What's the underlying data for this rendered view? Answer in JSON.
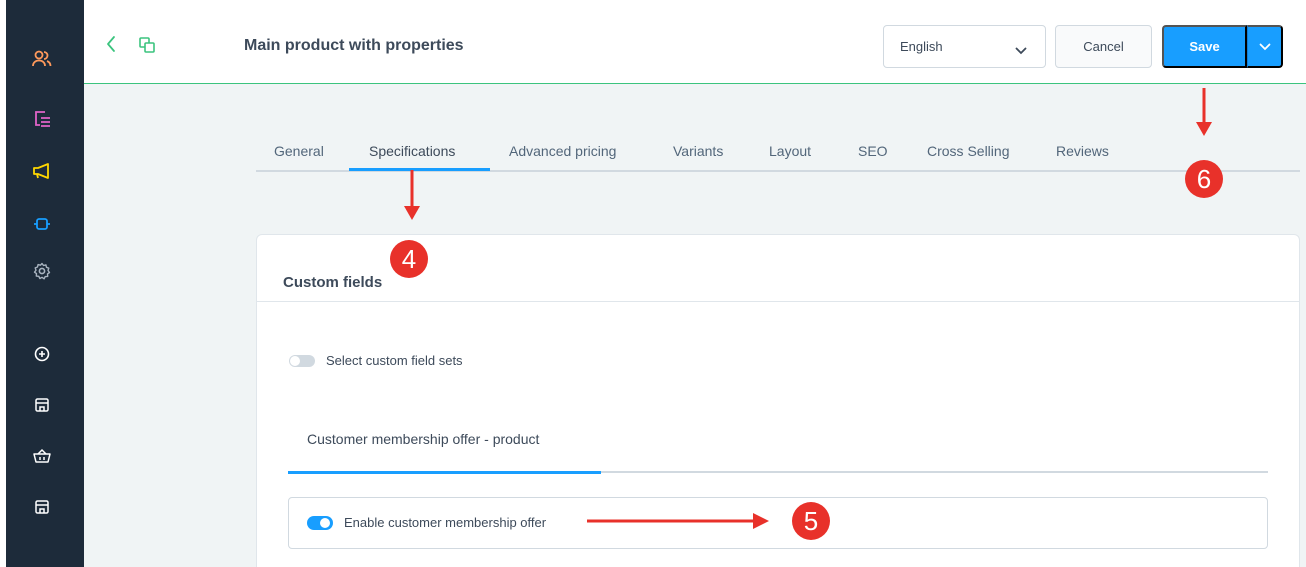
{
  "topbar": {
    "title": "Main product with properties",
    "language": "English",
    "cancel_label": "Cancel",
    "save_label": "Save"
  },
  "sidebar": {
    "icons": [
      {
        "name": "customers-icon",
        "color": "#ff9a5c"
      },
      {
        "name": "orders-icon",
        "color": "#e063c7"
      },
      {
        "name": "marketing-icon",
        "color": "#ffd700"
      },
      {
        "name": "extensions-icon",
        "color": "#189eff"
      },
      {
        "name": "settings-icon",
        "color": "#a9b4c0"
      },
      {
        "name": "add-icon",
        "color": "#ffffff"
      },
      {
        "name": "storefront-icon",
        "color": "#ffffff"
      },
      {
        "name": "basket-icon",
        "color": "#ffffff"
      },
      {
        "name": "storefront-2-icon",
        "color": "#ffffff"
      }
    ]
  },
  "tabs": [
    "General",
    "Specifications",
    "Advanced pricing",
    "Variants",
    "Layout",
    "SEO",
    "Cross Selling",
    "Reviews"
  ],
  "active_tab": "Specifications",
  "card": {
    "title": "Custom fields",
    "select_sets_label": "Select custom field sets",
    "set_tab_label": "Customer membership offer - product",
    "enable_label": "Enable customer membership offer",
    "enable_checked": true
  },
  "annotations": {
    "badge_4": "4",
    "badge_5": "5",
    "badge_6": "6"
  },
  "colors": {
    "accent": "#189eff",
    "annotation": "#e8312a",
    "sidebar_bg": "#1d2b3a"
  }
}
